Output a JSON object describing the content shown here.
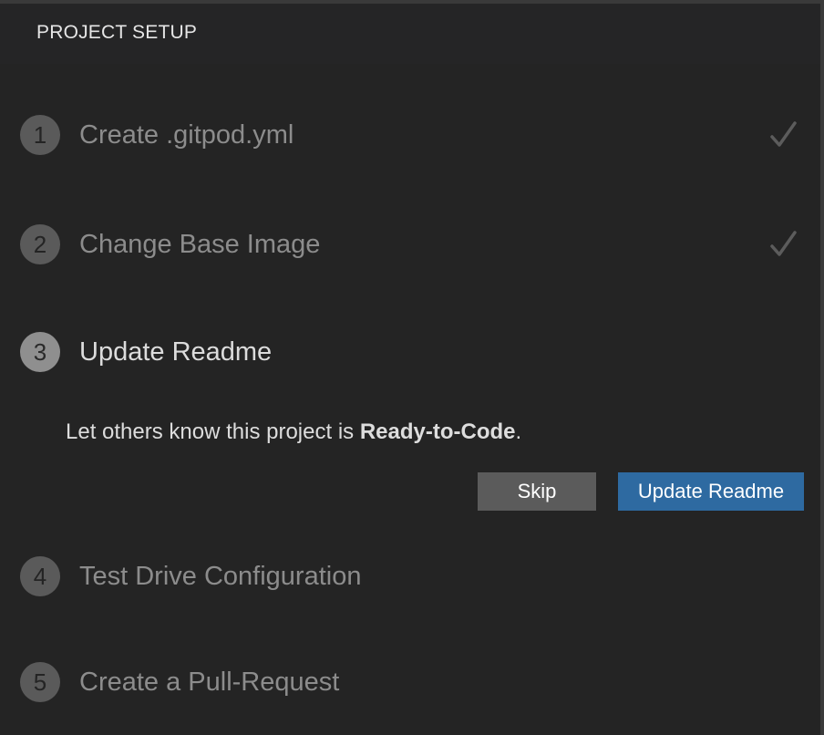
{
  "header": {
    "title": "PROJECT SETUP"
  },
  "steps": [
    {
      "number": "1",
      "label": "Create .gitpod.yml",
      "status": "done"
    },
    {
      "number": "2",
      "label": "Change Base Image",
      "status": "done"
    },
    {
      "number": "3",
      "label": "Update Readme",
      "status": "active"
    },
    {
      "number": "4",
      "label": "Test Drive Configuration",
      "status": "pending"
    },
    {
      "number": "5",
      "label": "Create a Pull-Request",
      "status": "pending"
    }
  ],
  "active_step": {
    "description_prefix": "Let others know this project is ",
    "description_bold": "Ready-to-Code",
    "description_suffix": ".",
    "skip_label": "Skip",
    "primary_label": "Update Readme"
  },
  "colors": {
    "background": "#252526",
    "primary_button": "#2e6aa1",
    "secondary_button": "#5b5b5b"
  },
  "icons": {
    "done": "check-icon"
  }
}
